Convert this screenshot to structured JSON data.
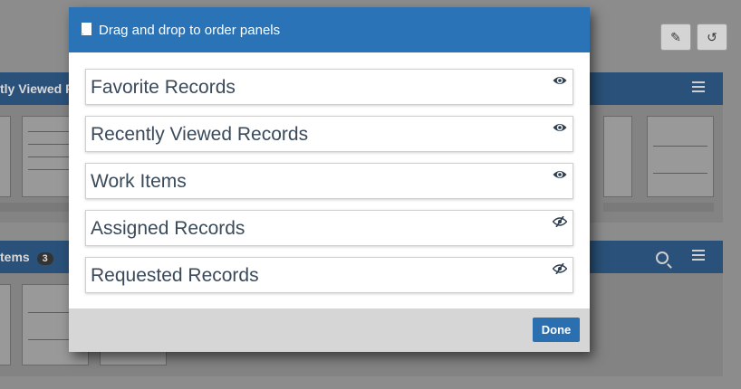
{
  "modal": {
    "title": "Drag and drop to order panels",
    "items": [
      {
        "label": "Favorite Records",
        "visible": true
      },
      {
        "label": "Recently Viewed Records",
        "visible": true
      },
      {
        "label": "Work Items",
        "visible": true
      },
      {
        "label": "Assigned Records",
        "visible": false
      },
      {
        "label": "Requested Records",
        "visible": false
      }
    ],
    "done_label": "Done"
  },
  "background": {
    "panel1_title": "tly Viewed R",
    "panel2_title": "tems",
    "panel2_count": "3"
  },
  "colors": {
    "modal_header": "#2a73b6",
    "done_button": "#2a6fb0",
    "panel_header": "#2a5179"
  }
}
